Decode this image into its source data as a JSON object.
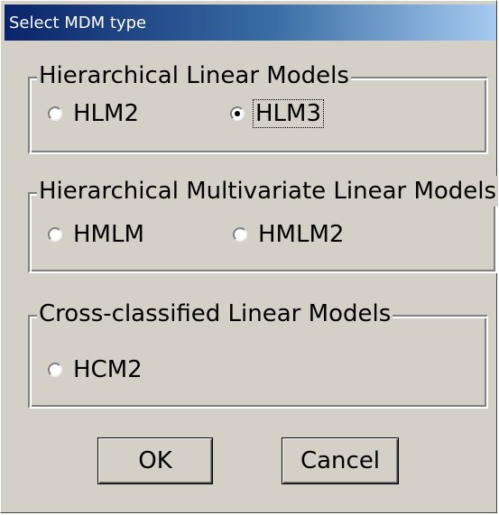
{
  "window": {
    "title": "Select MDM type"
  },
  "groups": [
    {
      "legend": "Hierarchical Linear Models",
      "options": [
        {
          "label": "HLM2",
          "selected": false
        },
        {
          "label": "HLM3",
          "selected": true
        }
      ]
    },
    {
      "legend": "Hierarchical Multivariate Linear Models",
      "options": [
        {
          "label": "HMLM",
          "selected": false
        },
        {
          "label": "HMLM2",
          "selected": false
        }
      ]
    },
    {
      "legend": "Cross-classified Linear Models",
      "options": [
        {
          "label": "HCM2",
          "selected": false
        }
      ]
    }
  ],
  "buttons": {
    "ok_label": "OK",
    "cancel_label": "Cancel"
  },
  "colors": {
    "dialog_bg": "#d4d0c8",
    "title_start": "#0a246a",
    "title_end": "#a6caf0"
  }
}
